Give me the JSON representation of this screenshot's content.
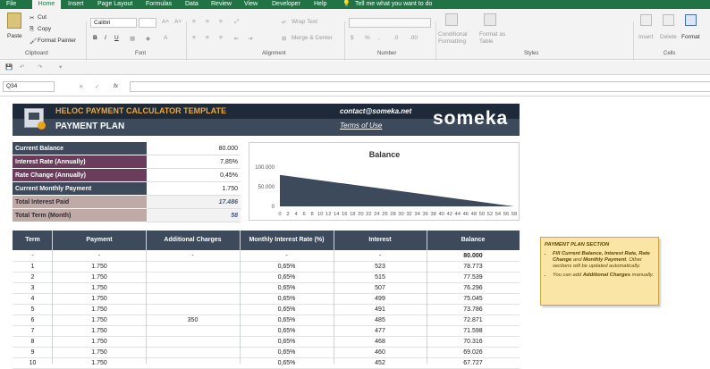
{
  "tabs": [
    "File",
    "Home",
    "Insert",
    "Page Layout",
    "Formulas",
    "Data",
    "Review",
    "View",
    "Developer",
    "Help",
    "Tell me what you want to do"
  ],
  "ribbon": {
    "clipboard": {
      "paste": "Paste",
      "cut": "Cut",
      "copy": "Copy",
      "format_painter": "Format Painter",
      "group": "Clipboard"
    },
    "font": {
      "name": "Calibri",
      "group": "Font"
    },
    "alignment": {
      "wrap": "Wrap Text",
      "merge": "Merge & Center",
      "group": "Alignment"
    },
    "number": {
      "group": "Number"
    },
    "styles": {
      "conditional": "Conditional Formatting",
      "format_table": "Format as Table",
      "group": "Styles"
    },
    "cells": {
      "insert": "Insert",
      "delete": "Delete",
      "format": "Format",
      "group": "Cells"
    }
  },
  "formula_bar": {
    "name_box": "Q34",
    "fx": "fx",
    "formula": ""
  },
  "header": {
    "title": "HELOC PAYMENT CALCULATOR TEMPLATE",
    "subtitle": "PAYMENT PLAN",
    "email": "contact@someka.net",
    "terms": "Terms of Use",
    "brand": "someka"
  },
  "summary": [
    {
      "label": "Current Balance",
      "value": "80.000",
      "color": "#3c4a5c"
    },
    {
      "label": "Interest Rate (Annually)",
      "value": "7,85%",
      "color": "#6b3d5c"
    },
    {
      "label": "Rate Change (Annually)",
      "value": "0,45%",
      "color": "#6b3d5c"
    },
    {
      "label": "Current Monthly Payment",
      "value": "1.750",
      "color": "#3c4a5c"
    },
    {
      "label": "Total Interest Paid",
      "value": "17.486",
      "color": "#bfaaa8"
    },
    {
      "label": "Total Term (Month)",
      "value": "58",
      "color": "#bfaaa8"
    }
  ],
  "chart_data": {
    "type": "area",
    "title": "Balance",
    "x": [
      0,
      58
    ],
    "y": [
      80000,
      0
    ],
    "xticks": [
      0,
      2,
      4,
      6,
      8,
      10,
      12,
      14,
      16,
      18,
      20,
      22,
      24,
      26,
      28,
      30,
      32,
      34,
      36,
      38,
      40,
      42,
      44,
      46,
      48,
      50,
      52,
      54,
      56,
      58
    ],
    "yticks": [
      "100.000",
      "50.000",
      "0"
    ],
    "ylim": [
      0,
      100000
    ],
    "color": "#3c4a5c"
  },
  "table": {
    "headers": [
      "Term",
      "Payment",
      "Additional Charges",
      "Monthly Interest Rate (%)",
      "Interest",
      "Balance"
    ],
    "rows": [
      [
        "-",
        "-",
        "-",
        "-",
        "-",
        "80.000"
      ],
      [
        "1",
        "1.750",
        "",
        "0,65%",
        "523",
        "78.773"
      ],
      [
        "2",
        "1.750",
        "",
        "0,65%",
        "515",
        "77.539"
      ],
      [
        "3",
        "1.750",
        "",
        "0,65%",
        "507",
        "76.296"
      ],
      [
        "4",
        "1.750",
        "",
        "0,65%",
        "499",
        "75.045"
      ],
      [
        "5",
        "1.750",
        "",
        "0,65%",
        "491",
        "73.786"
      ],
      [
        "6",
        "1.750",
        "350",
        "0,65%",
        "485",
        "72.871"
      ],
      [
        "7",
        "1.750",
        "",
        "0,65%",
        "477",
        "71.598"
      ],
      [
        "8",
        "1.750",
        "",
        "0,65%",
        "468",
        "70.316"
      ],
      [
        "9",
        "1.750",
        "",
        "0,65%",
        "460",
        "69.026"
      ],
      [
        "10",
        "1.750",
        "",
        "0,65%",
        "452",
        "67.727"
      ]
    ]
  },
  "note": {
    "title": "PAYMENT PLAN SECTION",
    "item1": "Fill Current Balance, Interest Rate, Rate Change and Monthly Payment. Other sections will be updated automatically.",
    "item2": "You can add Additional Charges manually."
  }
}
